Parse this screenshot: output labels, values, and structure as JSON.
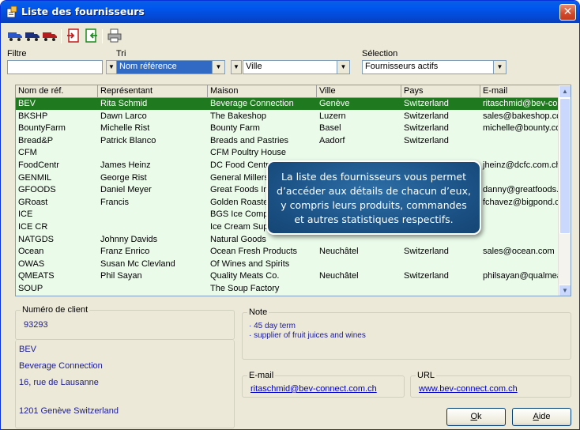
{
  "window": {
    "title": "Liste des fournisseurs",
    "close_glyph": "✕"
  },
  "toolbar": {
    "icons": [
      "truck-blue-icon",
      "truck-dark-icon",
      "truck-red-icon",
      "export-icon",
      "import-icon",
      "print-icon"
    ]
  },
  "filter": {
    "label": "Filtre",
    "value": ""
  },
  "sort": {
    "label": "Tri",
    "selected": "Nom référence",
    "second": "Ville"
  },
  "selection": {
    "label": "Sélection",
    "selected": "Fournisseurs actifs"
  },
  "grid": {
    "columns": [
      "Nom de réf.",
      "Représentant",
      "Maison",
      "Ville",
      "Pays",
      "E-mail"
    ],
    "rows": [
      [
        "BEV",
        "Rita Schmid",
        "Beverage Connection",
        "Genève",
        "Switzerland",
        "ritaschmid@bev-con"
      ],
      [
        "BKSHP",
        "Dawn Larco",
        "The Bakeshop",
        "Luzern",
        "Switzerland",
        "sales@bakeshop.co"
      ],
      [
        "BountyFarm",
        "Michelle Rist",
        "Bounty Farm",
        "Basel",
        "Switzerland",
        "michelle@bounty.co"
      ],
      [
        "Bread&P",
        "Patrick Blanco",
        "Breads and Pastries",
        "Aadorf",
        "Switzerland",
        ""
      ],
      [
        "CFM",
        "",
        "CFM Poultry House",
        "",
        "",
        ""
      ],
      [
        "FoodCentr",
        "James Heinz",
        "DC Food Centra",
        "",
        "",
        "jheinz@dcfc.com.ch"
      ],
      [
        "GENMIL",
        "George Rist",
        "General Millers",
        "",
        "",
        ""
      ],
      [
        "GFOODS",
        "Daniel Meyer",
        "Great Foods In",
        "",
        "",
        "danny@greatfoods.c"
      ],
      [
        "GRoast",
        "Francis",
        "Golden Roaste",
        "",
        "",
        "fchavez@bigpond.c"
      ],
      [
        "ICE",
        "",
        "BGS Ice Comp",
        "",
        "",
        ""
      ],
      [
        "ICE CR",
        "",
        "Ice Cream Supre",
        "",
        "",
        ""
      ],
      [
        "NATGDS",
        "Johnny Davids",
        "Natural Goods",
        "",
        "",
        ""
      ],
      [
        "Ocean",
        "Franz Enrico",
        "Ocean Fresh Products",
        "Neuchâtel",
        "Switzerland",
        "sales@ocean.com"
      ],
      [
        "OWAS",
        "Susan Mc Clevland",
        "Of Wines and Spirits",
        "",
        "",
        ""
      ],
      [
        "QMEATS",
        "Phil Sayan",
        "Quality Meats Co.",
        "Neuchâtel",
        "Switzerland",
        "philsayan@qualmeat"
      ],
      [
        "SOUP",
        "",
        "The Soup Factory",
        "",
        "",
        ""
      ]
    ]
  },
  "client": {
    "number_label": "Numéro de client",
    "number": "93293",
    "address_lines": [
      "BEV",
      "Beverage Connection",
      "16, rue de Lausanne",
      "1201 Genève Switzerland"
    ]
  },
  "note": {
    "label": "Note",
    "lines": [
      "· 45 day term",
      "· supplier of fruit juices and wines"
    ]
  },
  "email": {
    "label": "E-mail",
    "value": "ritaschmid@bev-connect.com.ch"
  },
  "url": {
    "label": "URL",
    "value": "www.bev-connect.com.ch"
  },
  "buttons": {
    "ok_rest": "k",
    "ok_mnemonic": "O",
    "help_rest": "ide",
    "help_mnemonic": "A"
  },
  "tooltip": {
    "text": "La liste des fournisseurs vous permet d’accéder aux détails de chacun d’eux, y compris leurs produits,  commandes et autres statistiques respectifs."
  },
  "colors": {
    "selected_row": "#1f7a1f",
    "grid_bg": "#eafbea",
    "titlebar": "#0058ee",
    "tooltip": "#1a4f82"
  }
}
